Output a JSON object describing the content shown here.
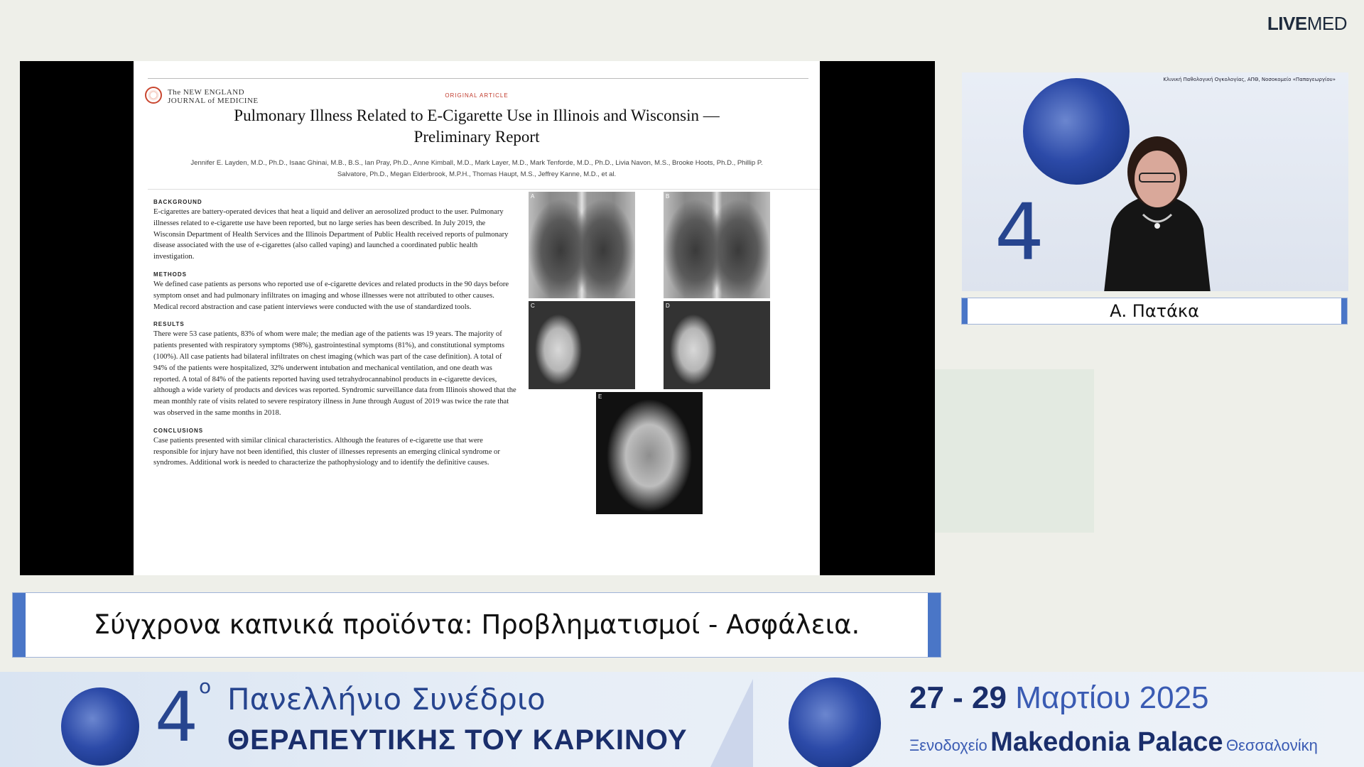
{
  "logo": {
    "live": "LIVE",
    "med": "MED"
  },
  "slide": {
    "journal_name_line1": "The NEW ENGLAND",
    "journal_name_line2": "JOURNAL of MEDICINE",
    "kicker": "ORIGINAL ARTICLE",
    "title": "Pulmonary Illness Related to E-Cigarette Use in Illinois and Wisconsin — Preliminary Report",
    "authors": "Jennifer E. Layden, M.D., Ph.D., Isaac Ghinai, M.B., B.S., Ian Pray, Ph.D., Anne Kimball, M.D., Mark Layer, M.D., Mark Tenforde, M.D., Ph.D., Livia Navon, M.S., Brooke Hoots, Ph.D., Phillip P. Salvatore, Ph.D., Megan Elderbrook, M.P.H., Thomas Haupt, M.S., Jeffrey Kanne, M.D., et al.",
    "sections": [
      {
        "heading": "BACKGROUND",
        "text": "E-cigarettes are battery-operated devices that heat a liquid and deliver an aerosolized product to the user. Pulmonary illnesses related to e-cigarette use have been reported, but no large series has been described. In July 2019, the Wisconsin Department of Health Services and the Illinois Department of Public Health received reports of pulmonary disease associated with the use of e-cigarettes (also called vaping) and launched a coordinated public health investigation."
      },
      {
        "heading": "METHODS",
        "text": "We defined case patients as persons who reported use of e-cigarette devices and related products in the 90 days before symptom onset and had pulmonary infiltrates on imaging and whose illnesses were not attributed to other causes. Medical record abstraction and case patient interviews were conducted with the use of standardized tools."
      },
      {
        "heading": "RESULTS",
        "text": "There were 53 case patients, 83% of whom were male; the median age of the patients was 19 years. The majority of patients presented with respiratory symptoms (98%), gastrointestinal symptoms (81%), and constitutional symptoms (100%). All case patients had bilateral infiltrates on chest imaging (which was part of the case definition). A total of 94% of the patients were hospitalized, 32% underwent intubation and mechanical ventilation, and one death was reported. A total of 84% of the patients reported having used tetrahydrocannabinol products in e-cigarette devices, although a wide variety of products and devices was reported. Syndromic surveillance data from Illinois showed that the mean monthly rate of visits related to severe respiratory illness in June through August of 2019 was twice the rate that was observed in the same months in 2018."
      },
      {
        "heading": "CONCLUSIONS",
        "text": "Case patients presented with similar clinical characteristics. Although the features of e-cigarette use that were responsible for injury have not been identified, this cluster of illnesses represents an emerging clinical syndrome or syndromes. Additional work is needed to characterize the pathophysiology and to identify the definitive causes."
      }
    ],
    "figure_labels": [
      "A",
      "B",
      "C",
      "D",
      "E"
    ]
  },
  "speaker": {
    "affiliation": "Κλινική Παθολογική Ογκολογίας, ΑΠΘ, Νοσοκομείο «Παπαγεωργίου»",
    "name": "Α. Πατάκα",
    "backdrop_number": "4"
  },
  "lower_third": "Σύγχρονα καπνικά προϊόντα: Προβληματισμοί - Ασφάλεια.",
  "footer": {
    "ordinal": "4",
    "ordinal_sup": "ο",
    "line1": "Πανελλήνιο Συνέδριο",
    "line2": "ΘΕΡΑΠΕΥΤΙΚΗΣ ΤΟΥ ΚΑΡΚΙΝΟΥ",
    "date_days": "27 - 29",
    "date_month": "Μαρτίου 2025",
    "venue_pre": "Ξενοδοχείο",
    "venue_name": "Makedonia Palace",
    "venue_city": "Θεσσαλονίκη"
  }
}
